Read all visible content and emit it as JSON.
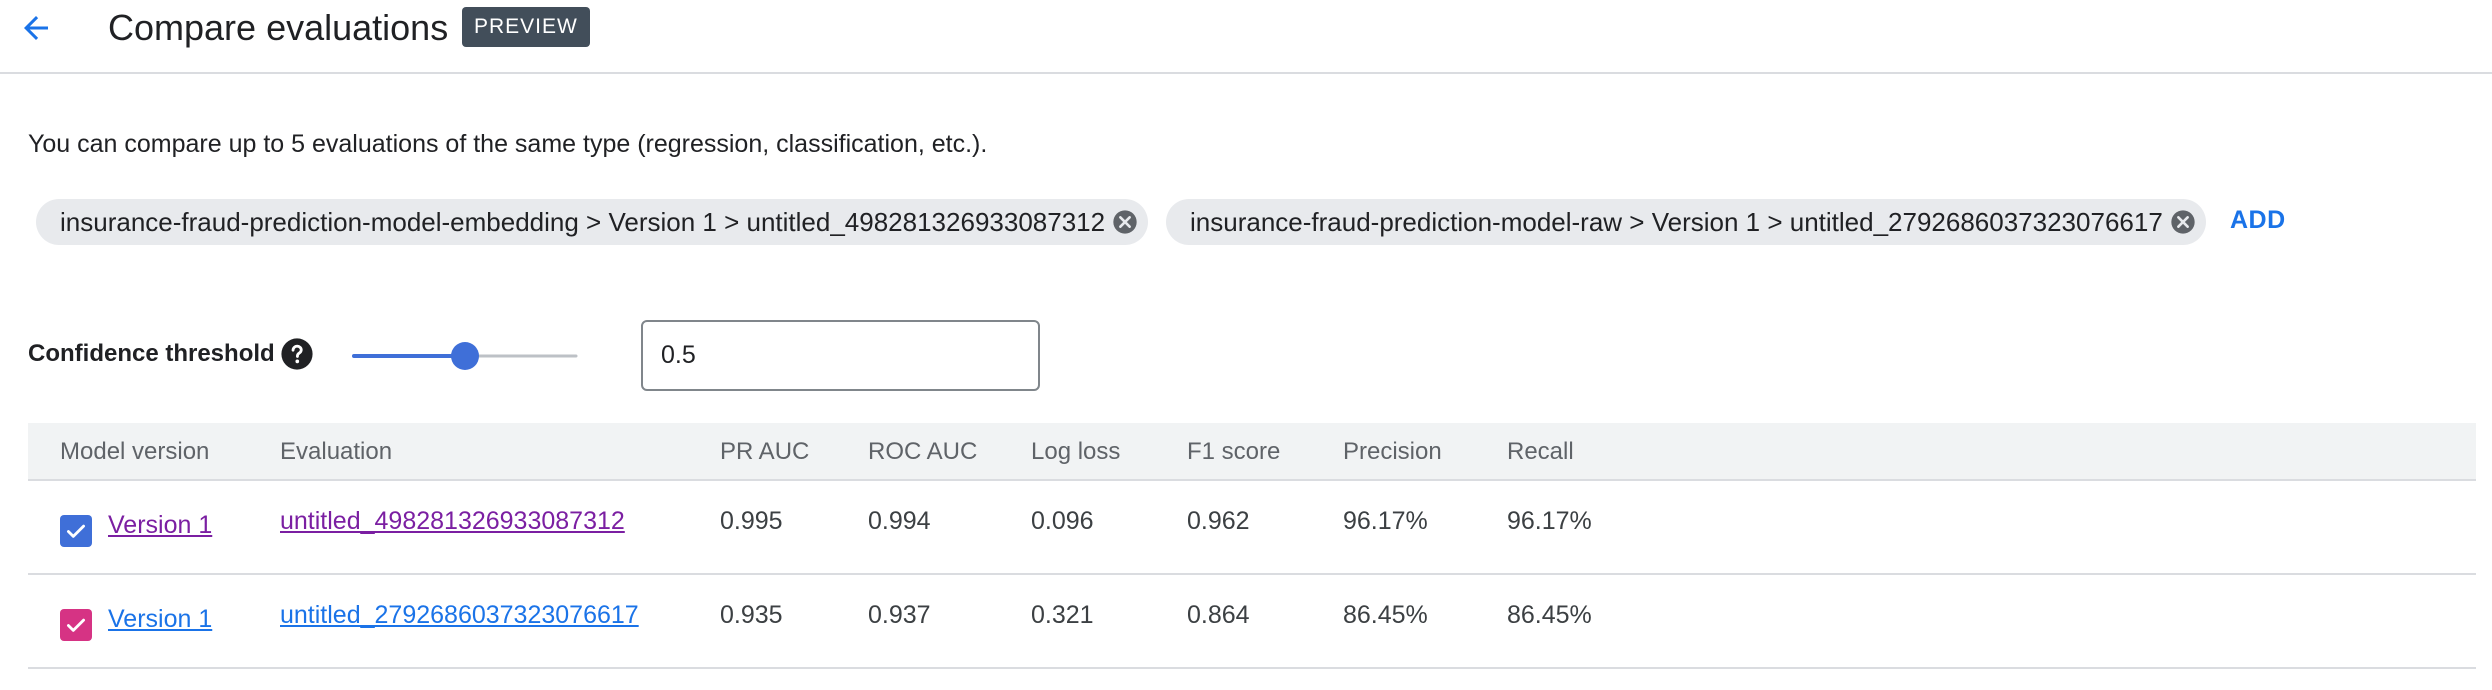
{
  "header": {
    "title": "Compare evaluations",
    "badge": "PREVIEW",
    "back_icon": "arrow-back-icon"
  },
  "intro_text": "You can compare up to 5 evaluations of the same type (regression, classification, etc.).",
  "chips": [
    {
      "label": "insurance-fraud-prediction-model-embedding > Version 1 > untitled_498281326933087312",
      "remove_icon": "close-circle-icon"
    },
    {
      "label": "insurance-fraud-prediction-model-raw > Version 1 > untitled_2792686037323076617",
      "remove_icon": "close-circle-icon"
    }
  ],
  "add_label": "ADD",
  "threshold": {
    "label": "Confidence threshold",
    "help_icon": "help-circle-icon",
    "value": "0.5",
    "slider_fraction": 0.5
  },
  "table": {
    "columns": [
      "Model version",
      "Evaluation",
      "PR AUC",
      "ROC AUC",
      "Log loss",
      "F1 score",
      "Precision",
      "Recall"
    ],
    "rows": [
      {
        "checked": true,
        "color": "#3f6fd8",
        "version": "Version 1",
        "evaluation": "untitled_498281326933087312",
        "pr_auc": "0.995",
        "roc_auc": "0.994",
        "log_loss": "0.096",
        "f1": "0.962",
        "precision": "96.17%",
        "recall": "96.17%"
      },
      {
        "checked": true,
        "color": "#d63384",
        "version": "Version 1",
        "evaluation": "untitled_2792686037323076617",
        "pr_auc": "0.935",
        "roc_auc": "0.937",
        "log_loss": "0.321",
        "f1": "0.864",
        "precision": "86.45%",
        "recall": "86.45%"
      }
    ]
  },
  "colors": {
    "accent": "#1a73e8",
    "slider": "#3f6fd8",
    "badge_bg": "#424e5a",
    "chip_bg": "#e8eaed"
  }
}
